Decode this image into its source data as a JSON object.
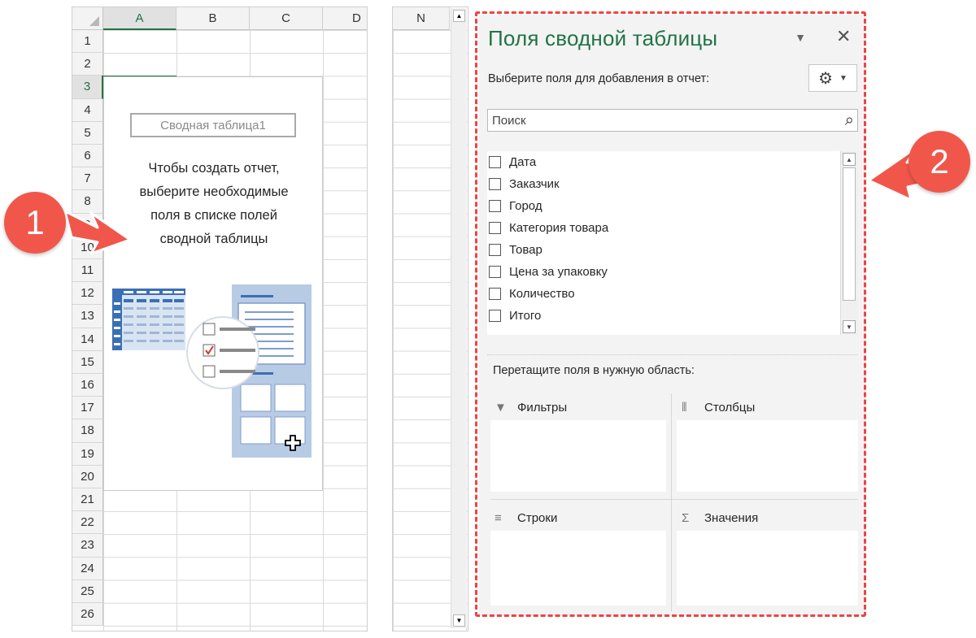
{
  "sheet_left": {
    "columns": [
      "A",
      "B",
      "C",
      "D"
    ],
    "active_column": "A",
    "rows": [
      "1",
      "2",
      "3",
      "4",
      "5",
      "6",
      "7",
      "8",
      "9",
      "10",
      "11",
      "12",
      "13",
      "14",
      "15",
      "16",
      "17",
      "18",
      "19",
      "20",
      "21",
      "22",
      "23",
      "24",
      "25",
      "26"
    ],
    "active_row": "3",
    "pivot_placeholder": {
      "name": "Сводная таблица1",
      "message_lines": [
        "Чтобы создать отчет,",
        "выберите необходимые",
        "поля в списке полей",
        "сводной таблицы"
      ]
    }
  },
  "sheet_right": {
    "column": "N"
  },
  "callouts": {
    "one": "1",
    "two": "2",
    "color": "#f0574a"
  },
  "panel": {
    "title": "Поля сводной таблицы",
    "subtitle": "Выберите поля для добавления в отчет:",
    "settings_icon": "gear-icon",
    "search_placeholder": "Поиск",
    "fields": [
      "Дата",
      "Заказчик",
      "Город",
      "Категория товара",
      "Товар",
      "Цена за упаковку",
      "Количество",
      "Итого"
    ],
    "drag_hint": "Перетащите поля в нужную область:",
    "areas": {
      "filters": "Фильтры",
      "columns": "Столбцы",
      "rows": "Строки",
      "values": "Значения"
    },
    "accent_color": "#217346",
    "highlight_color": "#ef4444"
  }
}
